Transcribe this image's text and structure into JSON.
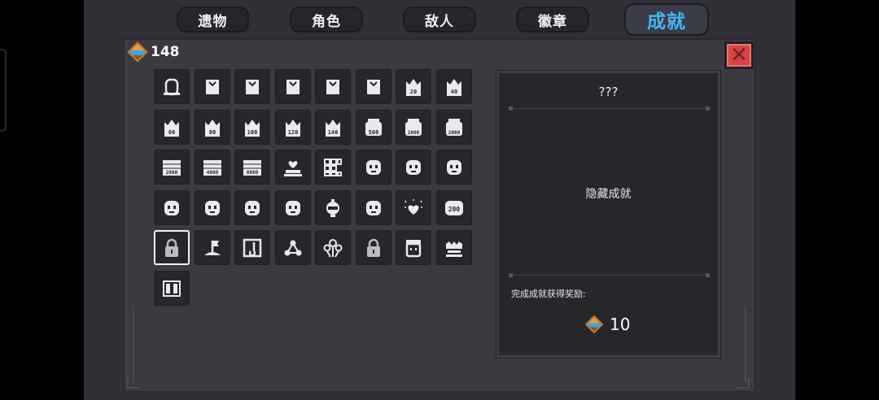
{
  "tabs": [
    {
      "label": "遗物",
      "active": false
    },
    {
      "label": "角色",
      "active": false
    },
    {
      "label": "敌人",
      "active": false
    },
    {
      "label": "徽章",
      "active": false
    },
    {
      "label": "成就",
      "active": true
    }
  ],
  "currency": {
    "icon": "gem-icon",
    "amount": "148"
  },
  "close_icon": "close-icon",
  "achievements": [
    {
      "icon": "door-icon",
      "label": ""
    },
    {
      "icon": "badge-level-1-icon",
      "label": ""
    },
    {
      "icon": "badge-level-2-icon",
      "label": ""
    },
    {
      "icon": "badge-level-3-icon",
      "label": ""
    },
    {
      "icon": "badge-level-4-icon",
      "label": ""
    },
    {
      "icon": "badge-level-5-icon",
      "label": ""
    },
    {
      "icon": "crown-badge-icon",
      "label": "20"
    },
    {
      "icon": "crown-badge-icon",
      "label": "40"
    },
    {
      "icon": "crown-badge-icon",
      "label": "60"
    },
    {
      "icon": "crown-badge-icon",
      "label": "80"
    },
    {
      "icon": "crown-badge-icon",
      "label": "100"
    },
    {
      "icon": "crown-badge-icon",
      "label": "120"
    },
    {
      "icon": "crown-badge-icon",
      "label": "140"
    },
    {
      "icon": "skull-badge-icon",
      "label": "500"
    },
    {
      "icon": "skull-badge-icon",
      "label": "1000"
    },
    {
      "icon": "skull-badge-icon",
      "label": "2000"
    },
    {
      "icon": "wall-badge-icon",
      "label": "2000"
    },
    {
      "icon": "wall-badge-icon",
      "label": "4000"
    },
    {
      "icon": "wall-badge-icon",
      "label": "8000"
    },
    {
      "icon": "heart-altar-icon",
      "label": ""
    },
    {
      "icon": "grid-icon",
      "label": ""
    },
    {
      "icon": "cat-face-icon",
      "label": ""
    },
    {
      "icon": "girl-face-icon",
      "label": ""
    },
    {
      "icon": "helmet-face-icon",
      "label": ""
    },
    {
      "icon": "robot-face-icon",
      "label": ""
    },
    {
      "icon": "block-face-icon",
      "label": ""
    },
    {
      "icon": "hooded-face-icon",
      "label": ""
    },
    {
      "icon": "bearded-face-icon",
      "label": ""
    },
    {
      "icon": "lantern-icon",
      "label": ""
    },
    {
      "icon": "glasses-face-icon",
      "label": ""
    },
    {
      "icon": "sparkle-heart-icon",
      "label": ""
    },
    {
      "icon": "counter-badge-icon",
      "label": "200"
    },
    {
      "icon": "lock-icon",
      "label": ""
    },
    {
      "icon": "flag-hill-icon",
      "label": ""
    },
    {
      "icon": "music-note-icon",
      "label": ""
    },
    {
      "icon": "molecule-icon",
      "label": ""
    },
    {
      "icon": "flowers-icon",
      "label": ""
    },
    {
      "icon": "lock-icon",
      "label": ""
    },
    {
      "icon": "jar-face-icon",
      "label": ""
    },
    {
      "icon": "castle-icon",
      "label": ""
    },
    {
      "icon": "double-door-icon",
      "label": ""
    }
  ],
  "selected_index": 32,
  "detail": {
    "title": "???",
    "description": "隐藏成就",
    "reward_label": "完成成就获得奖励:",
    "reward_amount": "10",
    "reward_icon": "gem-icon"
  },
  "colors": {
    "active_tab": "#42b7f4",
    "close_button": "#d64545",
    "icon": "#ece8f0"
  }
}
